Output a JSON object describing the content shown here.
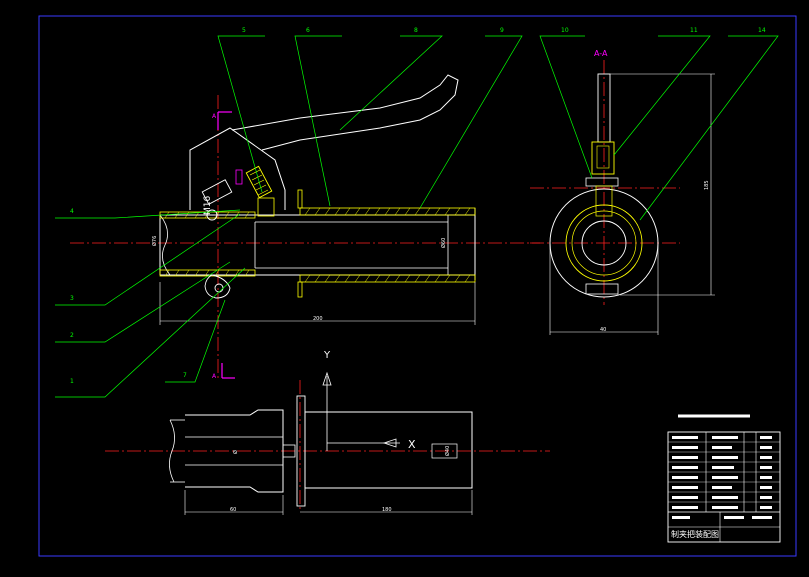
{
  "colors": {
    "background": "#000000",
    "border": "#3a3aff",
    "outline": "#ffffff",
    "leader": "#00ff00",
    "center": "#ff2020",
    "section": "#ffff00",
    "magenta": "#ff00ff"
  },
  "callouts": {
    "c1": "1",
    "c2": "2",
    "c3": "3",
    "c4": "4",
    "c5": "5",
    "c6": "6",
    "c7": "7",
    "c8": "8",
    "c9": "9",
    "c10": "10",
    "c11": "11",
    "c14": "14"
  },
  "section": {
    "label": "A-A"
  },
  "cut_marks": {
    "top": "A",
    "bottom": "A"
  },
  "dimensions": {
    "main_length": "200",
    "left_dia": "Ø76",
    "bore_dia": "Ø60",
    "section_width": "40",
    "section_height": "185",
    "bottom_left": "60",
    "bottom_right": "180",
    "bottom_dia": "Ø",
    "bottom_small": "Ø40",
    "side_note": "M16"
  },
  "axes": {
    "y": "Y",
    "x": "X"
  },
  "title_block": {
    "drawing_title": "制夹把装配图"
  }
}
